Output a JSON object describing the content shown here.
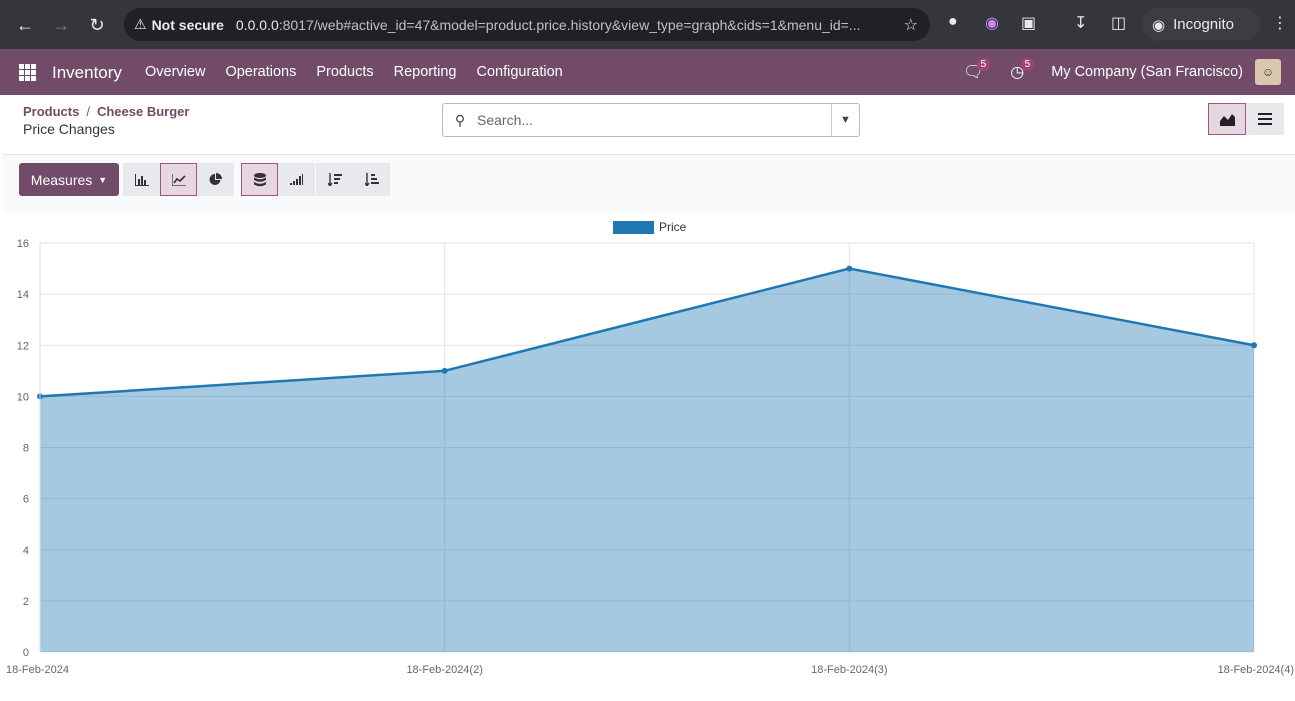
{
  "browser": {
    "security_label": "Not secure",
    "url_host": "0.0.0.0",
    "url_rest": ":8017/web#active_id=47&model=product.price.history&view_type=graph&cids=1&menu_id=...",
    "incognito_label": "Incognito"
  },
  "navbar": {
    "app_name": "Inventory",
    "menu": [
      "Overview",
      "Operations",
      "Products",
      "Reporting",
      "Configuration"
    ],
    "messages_count": "5",
    "activities_count": "5",
    "company": "My Company (San Francisco)",
    "accent": "#714b67"
  },
  "control_panel": {
    "breadcrumb_parent": "Products",
    "breadcrumb_current": "Cheese Burger",
    "title": "Price Changes",
    "search_placeholder": "Search..."
  },
  "toolbar": {
    "measures_label": "Measures"
  },
  "chart_data": {
    "type": "area",
    "categories": [
      "18-Feb-2024",
      "18-Feb-2024(2)",
      "18-Feb-2024(3)",
      "18-Feb-2024(4)"
    ],
    "series": [
      {
        "name": "Price",
        "values": [
          10,
          11,
          15,
          12
        ],
        "color": "#1f77b4"
      }
    ],
    "ylim": [
      0,
      16
    ],
    "yticks": [
      0,
      2,
      4,
      6,
      8,
      10,
      12,
      14,
      16
    ],
    "legend": "top-center",
    "grid": true
  }
}
